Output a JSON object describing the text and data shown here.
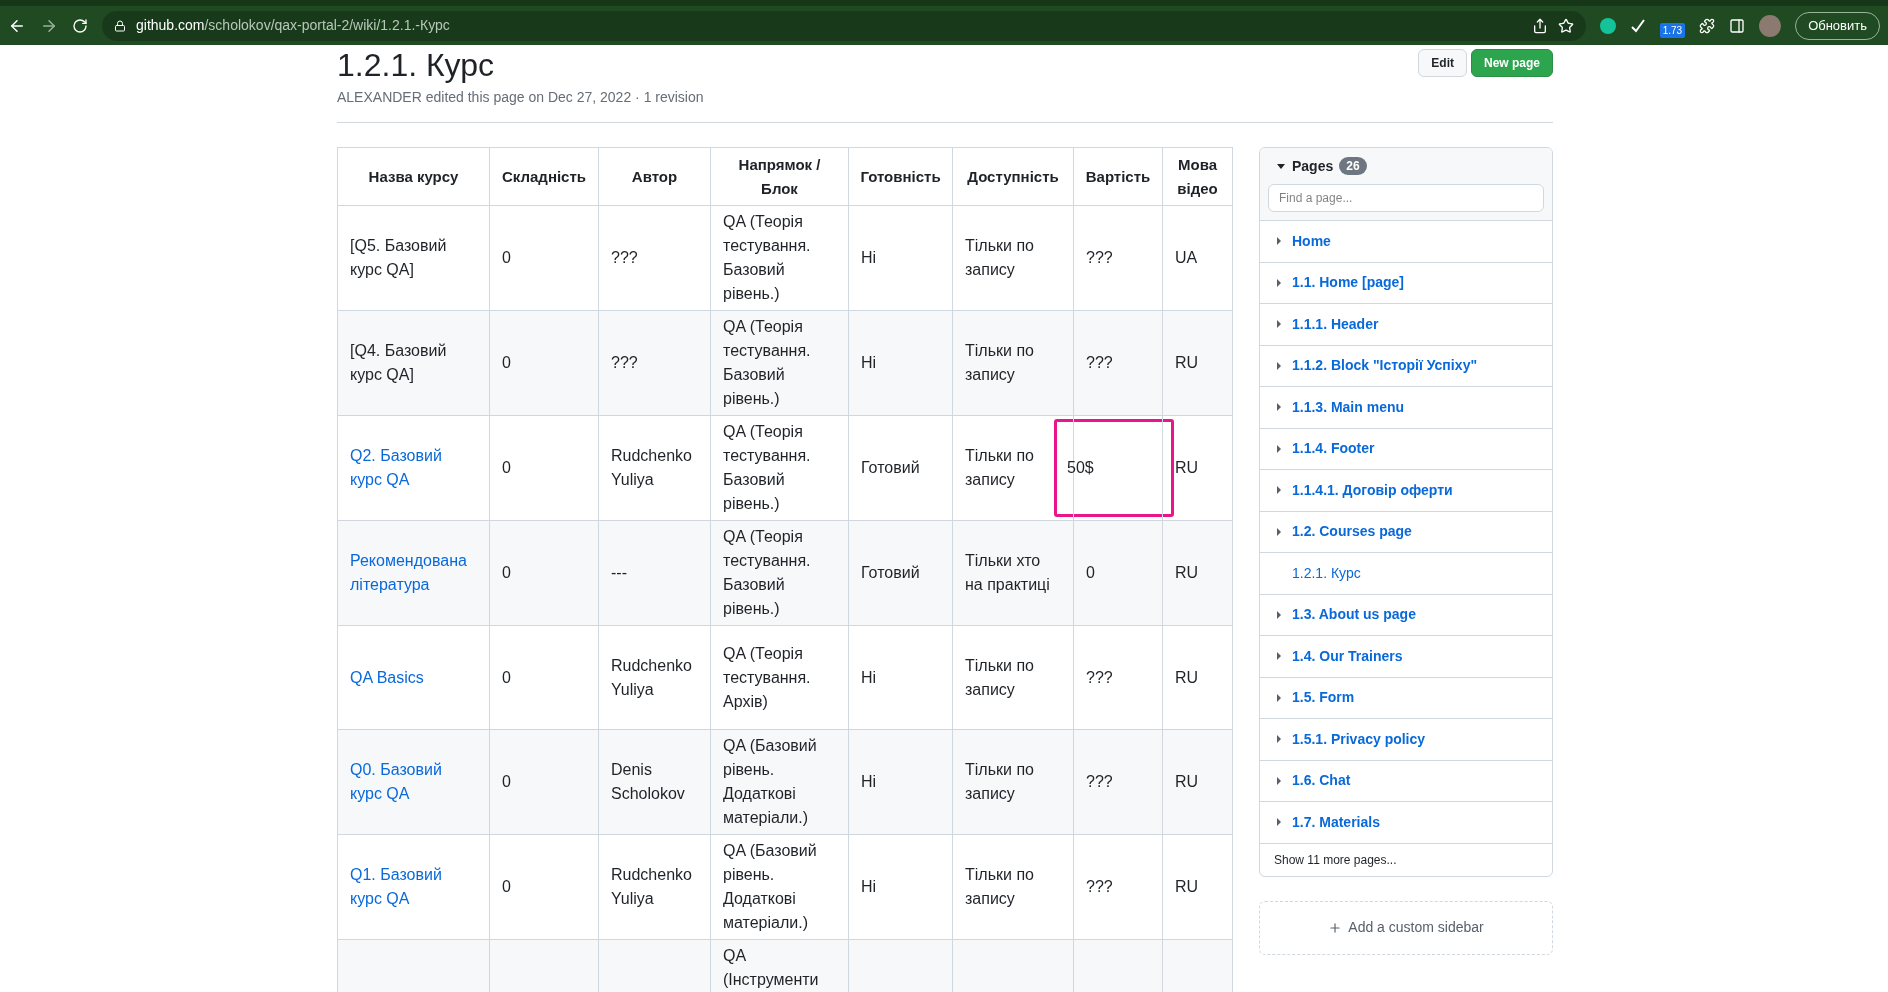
{
  "browser": {
    "url_host": "github.com",
    "url_path": "/scholokov/qax-portal-2/wiki/1.2.1.-Курс",
    "extension_badge": "1.73",
    "update_button": "Обновить"
  },
  "page": {
    "title": "1.2.1. Курс",
    "meta": "ALEXANDER edited this page on Dec 27, 2022 · 1 revision",
    "buttons": [
      {
        "label": "Edit",
        "kind": "plain"
      },
      {
        "label": "New page",
        "kind": "primary"
      }
    ]
  },
  "table": {
    "columns": [
      "Назва курсу",
      "Складність",
      "Автор",
      "Напрямок / Блок",
      "Готовність",
      "Доступність",
      "Вартість",
      "Мова відео"
    ],
    "rows": [
      {
        "name": "[Q5. Базовий курс QA]",
        "link": false,
        "difficulty": "0",
        "author": "???",
        "direction": "QA (Теорія тестування. Базовий рівень.)",
        "readiness": "Ні",
        "access": "Тільки по запису",
        "price": "???",
        "highlighted": false,
        "lang": "UA"
      },
      {
        "name": "[Q4. Базовий курс QA]",
        "link": false,
        "difficulty": "0",
        "author": "???",
        "direction": "QA (Теорія тестування. Базовий рівень.)",
        "readiness": "Ні",
        "access": "Тільки по запису",
        "price": "???",
        "highlighted": false,
        "lang": "RU"
      },
      {
        "name": "Q2. Базовий курс QA",
        "link": true,
        "difficulty": "0",
        "author": "Rudchenko Yuliya",
        "direction": "QA (Теорія тестування. Базовий рівень.)",
        "readiness": "Готовий",
        "access": "Тільки по запису",
        "price": "50$",
        "highlighted": true,
        "lang": "RU"
      },
      {
        "name": "Рекомендована література",
        "link": true,
        "difficulty": "0",
        "author": "---",
        "direction": "QA (Теорія тестування. Базовий рівень.)",
        "readiness": "Готовий",
        "access": "Тільки хто на практиці",
        "price": "0",
        "highlighted": false,
        "lang": "RU"
      },
      {
        "name": "QA Basics",
        "link": true,
        "difficulty": "0",
        "author": "Rudchenko Yuliya",
        "direction": "QA (Теорія тестування. Архів)",
        "readiness": "Ні",
        "access": "Тільки по запису",
        "price": "???",
        "highlighted": false,
        "lang": "RU"
      },
      {
        "name": "Q0. Базовий курс QA",
        "link": true,
        "difficulty": "0",
        "author": "Denis Scholokov",
        "direction": "QA (Базовий рівень. Додаткові матеріали.)",
        "readiness": "Ні",
        "access": "Тільки по запису",
        "price": "???",
        "highlighted": false,
        "lang": "RU"
      },
      {
        "name": "Q1. Базовий курс QA",
        "link": true,
        "difficulty": "0",
        "author": "Rudchenko Yuliya",
        "direction": "QA (Базовий рівень. Додаткові матеріали.)",
        "readiness": "Ні",
        "access": "Тільки по запису",
        "price": "???",
        "highlighted": false,
        "lang": "RU"
      },
      {
        "direction": "QA (Інструменти"
      }
    ]
  },
  "sidebar": {
    "title": "Pages",
    "count": "26",
    "expanded": true,
    "search_placeholder": "Find a page...",
    "items": [
      {
        "label": "Home",
        "has_children": true,
        "selected": false
      },
      {
        "label": "1.1. Home [page]",
        "has_children": true,
        "selected": false
      },
      {
        "label": "1.1.1. Header",
        "has_children": true,
        "selected": false
      },
      {
        "label": "1.1.2. Block \"Історії Успіху\"",
        "has_children": true,
        "selected": false
      },
      {
        "label": "1.1.3. Main menu",
        "has_children": true,
        "selected": false
      },
      {
        "label": "1.1.4. Footer",
        "has_children": true,
        "selected": false
      },
      {
        "label": "1.1.4.1. Договір оферти",
        "has_children": true,
        "selected": false
      },
      {
        "label": "1.2. Courses page",
        "has_children": true,
        "selected": false
      },
      {
        "label": "1.2.1. Курс",
        "has_children": false,
        "selected": true
      },
      {
        "label": "1.3. About us page",
        "has_children": true,
        "selected": false
      },
      {
        "label": "1.4. Our Trainers",
        "has_children": true,
        "selected": false
      },
      {
        "label": "1.5. Form",
        "has_children": true,
        "selected": false
      },
      {
        "label": "1.5.1. Privacy policy",
        "has_children": true,
        "selected": false
      },
      {
        "label": "1.6. Chat",
        "has_children": true,
        "selected": false
      },
      {
        "label": "1.7. Materials",
        "has_children": true,
        "selected": false
      }
    ],
    "more": "Show 11 more pages...",
    "add_sidebar": "Add a custom sidebar"
  }
}
